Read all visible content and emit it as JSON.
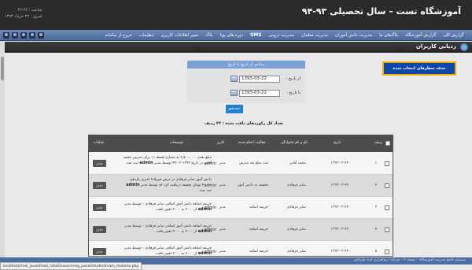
{
  "header": {
    "title": "آموزشگاه تست – سال تحصیلی ۹۳-۹۴",
    "clock_line1": "ساعت : ۲۲:۳۶",
    "clock_line2": "امروز : ۲۲ خرداد ۱۳۹۳"
  },
  "nav": {
    "items": [
      "گزارش کلی",
      "گزارش آموزشگاه",
      "بلاگ‌های ما",
      "مدیریت دانش آموزان",
      "مدیریت معلمان",
      "مدیریت دروس",
      "SMS",
      "دوره های پویا",
      "بلاگ",
      "تغییر اطلاعات کاربری",
      "تنظیمات",
      "خروج از سامانه"
    ]
  },
  "page": {
    "title": "ردیابی کاربران",
    "delete_selected": "حذف سطرهای انتخاب شده"
  },
  "search": {
    "heading": "ردیابی از تاریخ تا تاریخ",
    "from_label": "از تاریخ :",
    "from_value": "1393-03-22",
    "to_label": "تا تاریخ :",
    "to_value": "1393-03-22",
    "submit": "جستجو",
    "count_text": "تعداد کل رکوردهای یافت شده : ۴۲ ردیف"
  },
  "table": {
    "headers": {
      "index": "ردیف",
      "date": "تاریخ",
      "user": "نام و نام خانوادگی",
      "activity": "فعالیت انجام شده",
      "actor": "کاربر",
      "description": "توضیحات",
      "ops": "عملیات"
    },
    "rows": [
      {
        "index": "۱",
        "date": "۱۳۹۳-۰۳-۲۲",
        "user": "محمد آقایی",
        "activity": "ثبت مبلغ نقد مدرس",
        "actor": "admin",
        "actor_role": "مدیر",
        "desc_a": "مبلغ نقدی ۴,۵۰۰,۰۰۰ به شماره قسط ۱۱ برای مدرس محمد آقایی در",
        "desc_b": "تاریخ ۱۳۹۳-۰۳-۲۲ توسط مدیر",
        "desc_c": "ثبت شد.",
        "button": "حذف"
      },
      {
        "index": "۲",
        "date": "۱۳۹۳-۰۳-۲۲",
        "user": "صابر فرهادی",
        "activity": "تخفیف به دانش آموز",
        "actor": "admin",
        "actor_role": "مدیر",
        "desc_a": "دانش آموز صابر فرهادی در درس فیزیک۲ امیری یازدهم ۲۰۰۰۰",
        "desc_b": "تومان تخفیف دریافت کرد که توسط مدیر",
        "desc_c": "ثبت شد.",
        "button": "حذف"
      },
      {
        "index": "۳",
        "date": "۱۳۹۳-۰۳-۲۲",
        "user": "صابر فرهادی",
        "activity": "جریمه اضافه",
        "actor": "admin",
        "actor_role": "مدیر",
        "desc_a": "جریمه اضافه دانش آموز اضافی صابر فرهادی - توسط مدیر",
        "desc_b": "از ۲۰۰۰ به ۲۰۰۰ تغییر یافت.",
        "desc_c": "",
        "button": "حذف"
      },
      {
        "index": "۴",
        "date": "۱۳۹۳-۰۳-۲۲",
        "user": "صابر فرهادی",
        "activity": "جریمه اضافه",
        "actor": "admin",
        "actor_role": "مدیر",
        "desc_a": "جریمه اضافه دانش آموز اضافی صابر فرهادی - توسط مدیر",
        "desc_b": "از ۲۰۰۰ به ۲۰۰۰ تغییر یافت.",
        "desc_c": "",
        "button": "حذف"
      },
      {
        "index": "۵",
        "date": "۱۳۹۳-۰۳-۲۲",
        "user": "صابر فرهادی",
        "activity": "جریمه اضافه",
        "actor": "admin",
        "actor_role": "مدیر",
        "desc_a": "جریمه اضافه دانش آموز اضافی صابر فرهادی - توسط مدیر",
        "desc_b": "از ۲۰۰۰ به ۲۰۰۰ تغییر یافت.",
        "desc_c": "",
        "button": "حذف"
      }
    ]
  },
  "footer": {
    "text": "سیستم جامع مدیریت آموزشگاه – نسخه ۲ – شرکت نرم‌افزاری ایده طراحان",
    "status_url": "localhost/mali_javad/mali_tahsil/source/reg_panel/student/vam_mahane.php"
  },
  "colors": {
    "header_bg": "#2b2b2b",
    "nav_bg": "#5a7aab",
    "accent_blue": "#0d49a8",
    "accent_border": "#f0b000",
    "table_head": "#4d4d4d"
  }
}
